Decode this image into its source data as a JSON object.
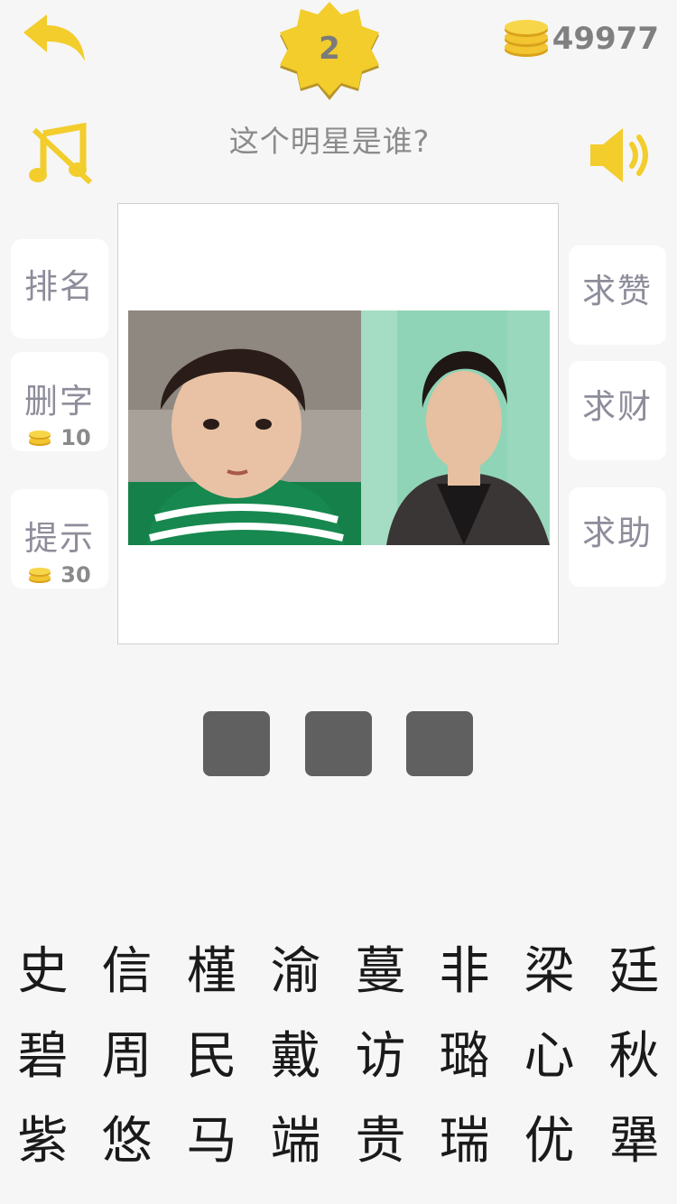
{
  "header": {
    "level": "2",
    "coins": "49977",
    "question": "这个明星是谁?"
  },
  "left_buttons": [
    {
      "label": "排名"
    },
    {
      "label": "删字",
      "cost": "10"
    },
    {
      "label": "提示",
      "cost": "30"
    }
  ],
  "right_buttons": [
    {
      "label": "求赞"
    },
    {
      "label": "求财"
    },
    {
      "label": "求助"
    }
  ],
  "answer_slots": 3,
  "characters": [
    "史",
    "信",
    "槿",
    "渝",
    "蔓",
    "非",
    "梁",
    "廷",
    "碧",
    "周",
    "民",
    "戴",
    "访",
    "璐",
    "心",
    "秋",
    "紫",
    "悠",
    "马",
    "端",
    "贵",
    "瑞",
    "优",
    "犟"
  ],
  "colors": {
    "accent_yellow": "#f2cd2c",
    "slot_gray": "#606060",
    "background": "#f6f6f6"
  },
  "icons": {
    "back": "back-arrow-icon",
    "music": "music-off-icon",
    "sound": "speaker-icon",
    "coin": "coin-stack-icon",
    "level": "star-badge-icon"
  }
}
